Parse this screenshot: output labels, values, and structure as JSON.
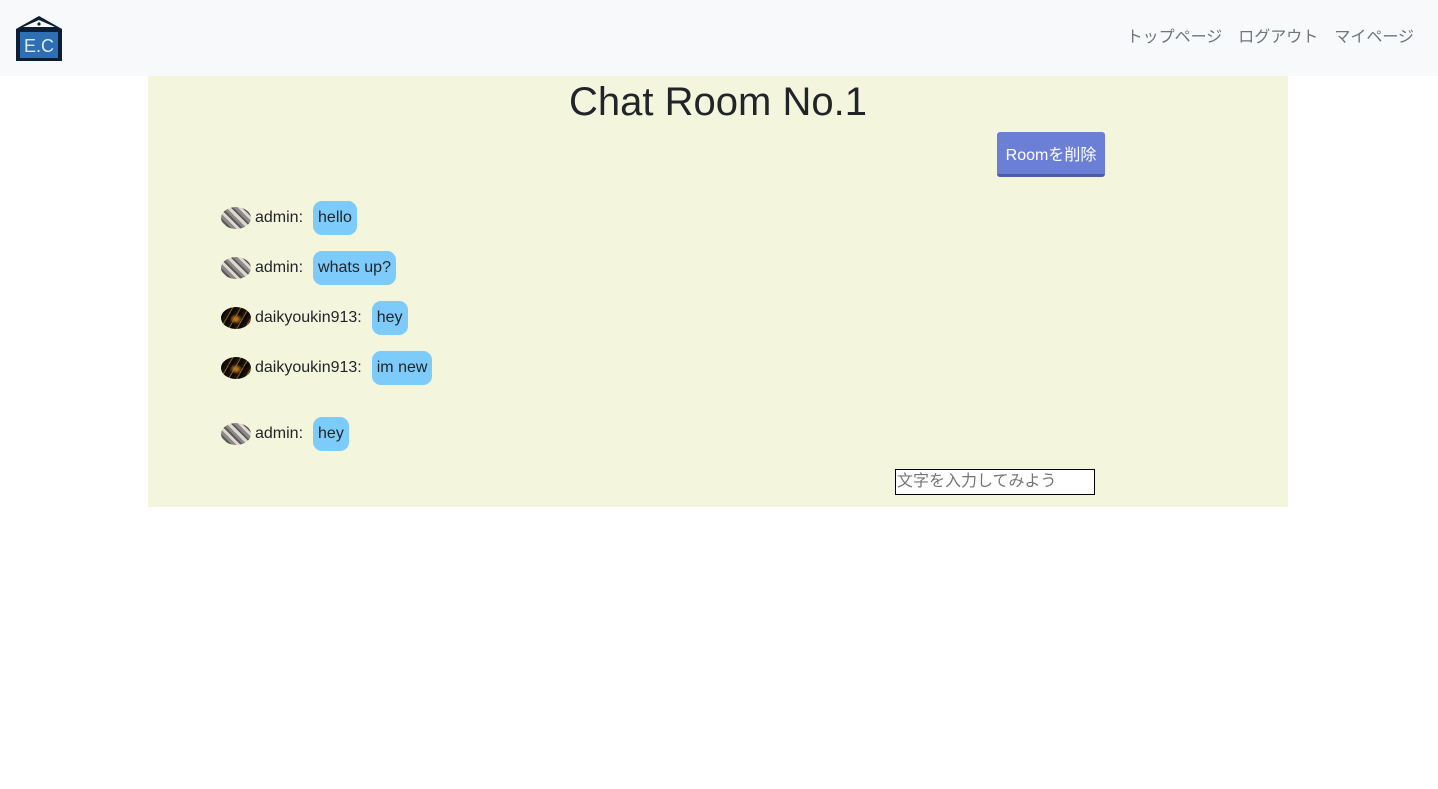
{
  "navbar": {
    "logo_text": "E.C",
    "links": [
      {
        "label": "トップページ"
      },
      {
        "label": "ログアウト"
      },
      {
        "label": "マイページ"
      }
    ]
  },
  "room": {
    "title": "Chat Room No.1",
    "delete_button_label": "Roomを削除",
    "messages": [
      {
        "user": "admin:",
        "text": "hello",
        "avatar": "admin-avatar"
      },
      {
        "user": "admin:",
        "text": "whats up?",
        "avatar": "admin-avatar"
      },
      {
        "user": "daikyoukin913:",
        "text": "hey",
        "avatar": "daikyoukin913-avatar"
      },
      {
        "user": "daikyoukin913:",
        "text": "im new",
        "avatar": "daikyoukin913-avatar"
      },
      {
        "user": "admin:",
        "text": "hey",
        "avatar": "admin-avatar"
      }
    ],
    "input": {
      "value": "",
      "placeholder": "文字を入力してみよう"
    }
  },
  "colors": {
    "navbar_bg": "#f8f9fa",
    "room_bg": "#f3f6dc",
    "button_bg": "#6b7fd7",
    "bubble_bg": "#7ccbfa"
  }
}
